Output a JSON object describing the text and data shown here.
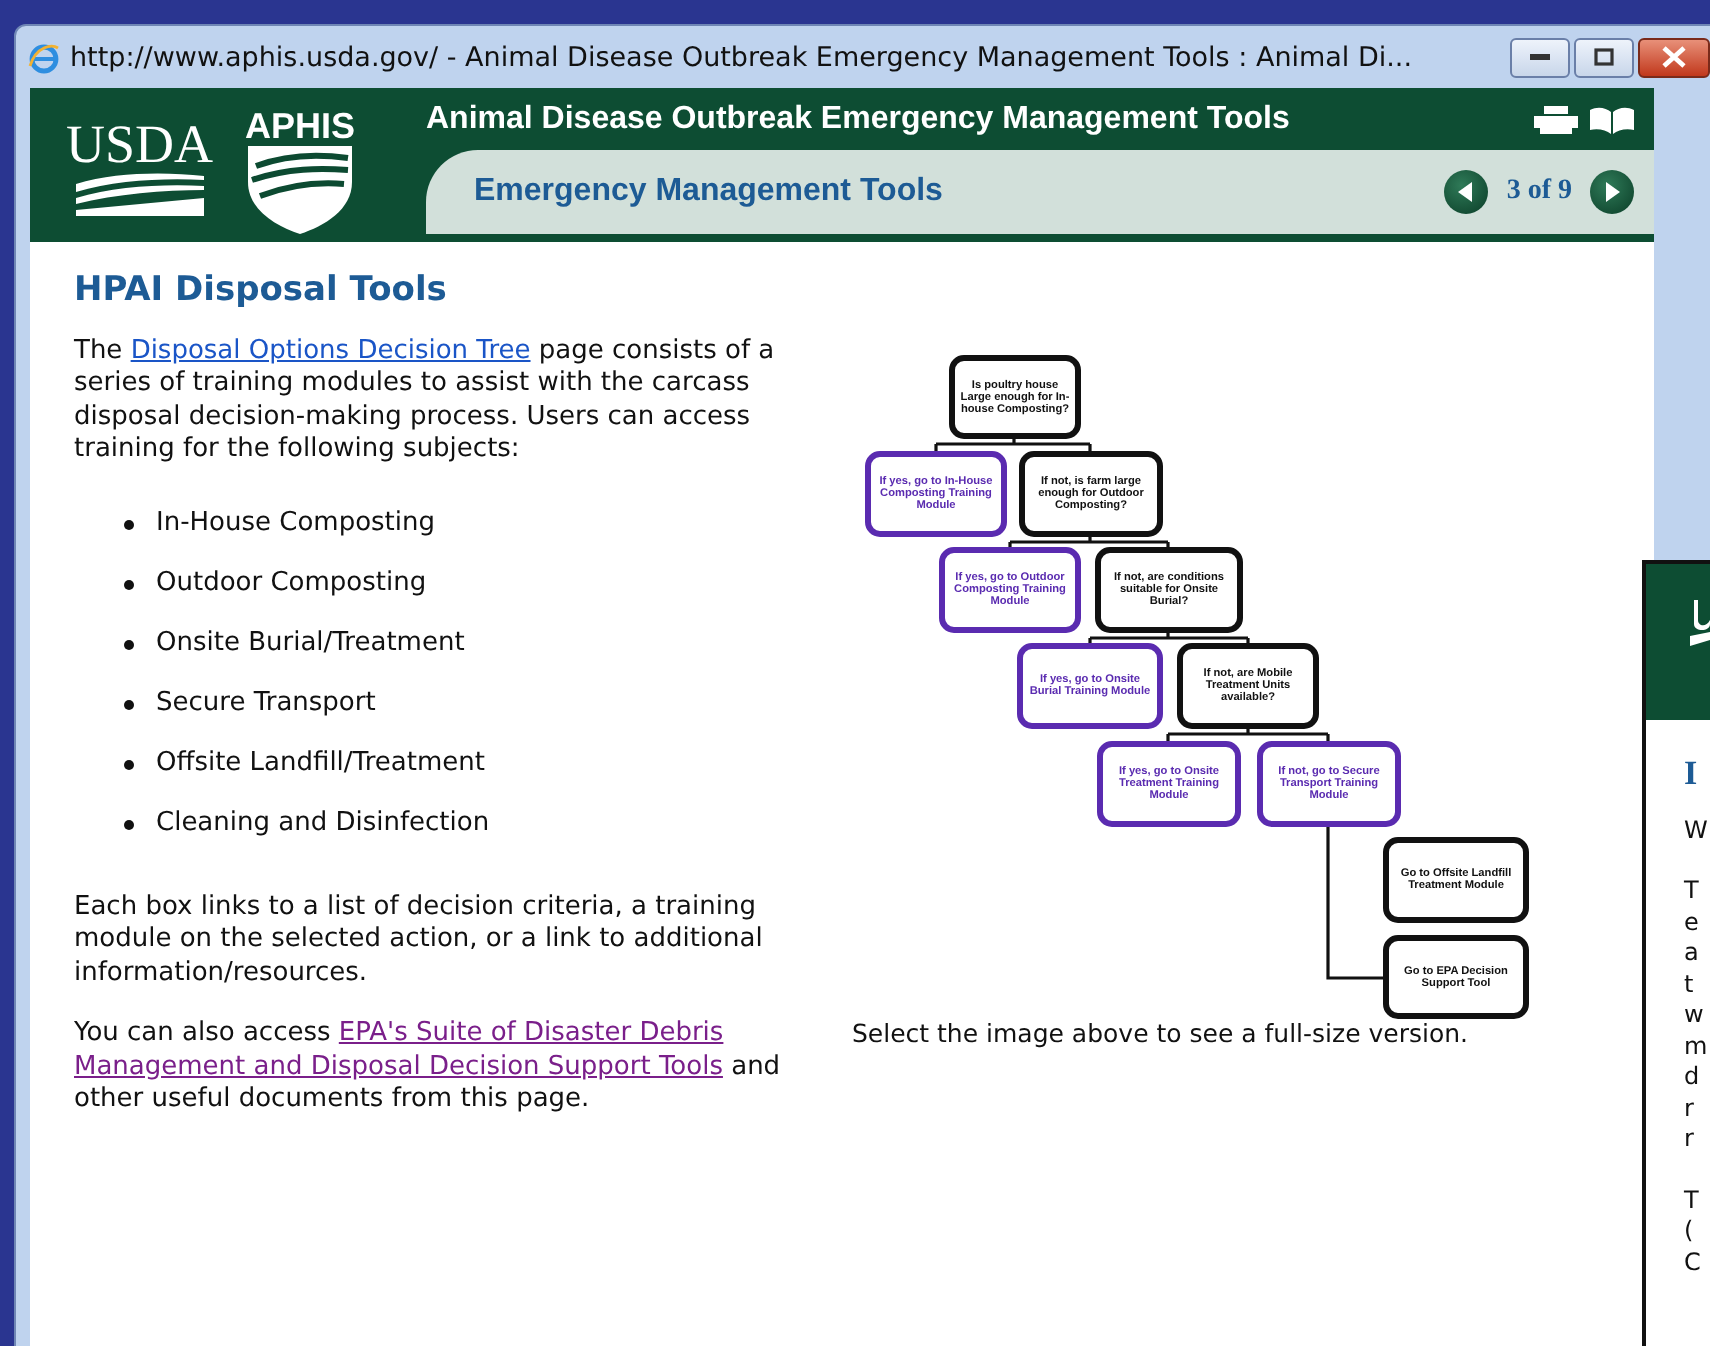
{
  "window": {
    "title": "http://www.aphis.usda.gov/ - Animal Disease Outbreak Emergency Management Tools : Animal Di..."
  },
  "header": {
    "logo_left": "USDA",
    "logo_right": "APHIS",
    "title": "Animal Disease Outbreak Emergency Management Tools",
    "subtitle": "Emergency Management Tools",
    "pager": "3 of 9"
  },
  "content": {
    "heading": "HPAI Disposal Tools",
    "intro_before": "The ",
    "intro_link": "Disposal Options Decision Tree",
    "intro_after": " page consists of a series of training modules to assist with the carcass disposal decision-making process. Users can access training for the following subjects:",
    "subjects": [
      "In-House Composting",
      "Outdoor Composting",
      "Onsite Burial/Treatment",
      "Secure Transport",
      "Offsite Landfill/Treatment",
      "Cleaning and Disinfection"
    ],
    "explanation": "Each box links to a list of decision criteria, a training module on the selected action, or a link to additional information/resources.",
    "also_before": "You can also access ",
    "also_link_lines": [
      "EPA's Suite of Disaster Debris",
      "Management and Disposal Decision Support Tools"
    ],
    "also_after": " and other useful documents from this page."
  },
  "decision_tree": {
    "nodes": [
      {
        "kind": "question",
        "text": "Is poultry house Large enough for In-house Composting?"
      },
      {
        "kind": "action",
        "text": "If yes, go to In-House Composting Training Module"
      },
      {
        "kind": "question",
        "text": "If not, is farm large enough for Outdoor Composting?"
      },
      {
        "kind": "action",
        "text": "If yes, go to Outdoor Composting Training Module"
      },
      {
        "kind": "question",
        "text": "If not, are conditions suitable for Onsite Burial?"
      },
      {
        "kind": "action",
        "text": "If yes, go to Onsite Burial Training Module"
      },
      {
        "kind": "question",
        "text": "If not, are Mobile Treatment Units available?"
      },
      {
        "kind": "action",
        "text": "If yes, go to Onsite Treatment Training Module"
      },
      {
        "kind": "action",
        "text": "If not, go to Secure Transport Training Module"
      },
      {
        "kind": "question",
        "text": "Go to Offsite Landfill Treatment Module"
      },
      {
        "kind": "question",
        "text": "Go to EPA Decision Support Tool"
      }
    ],
    "caption": "Select the image above to see a full-size version."
  },
  "background_window": {
    "heading": "I",
    "paragraphs": [
      [
        "W"
      ],
      [
        "T",
        "e",
        "a",
        "t",
        "w",
        "m",
        "d",
        "r",
        "r"
      ],
      [
        "T",
        "(",
        "C"
      ]
    ]
  }
}
